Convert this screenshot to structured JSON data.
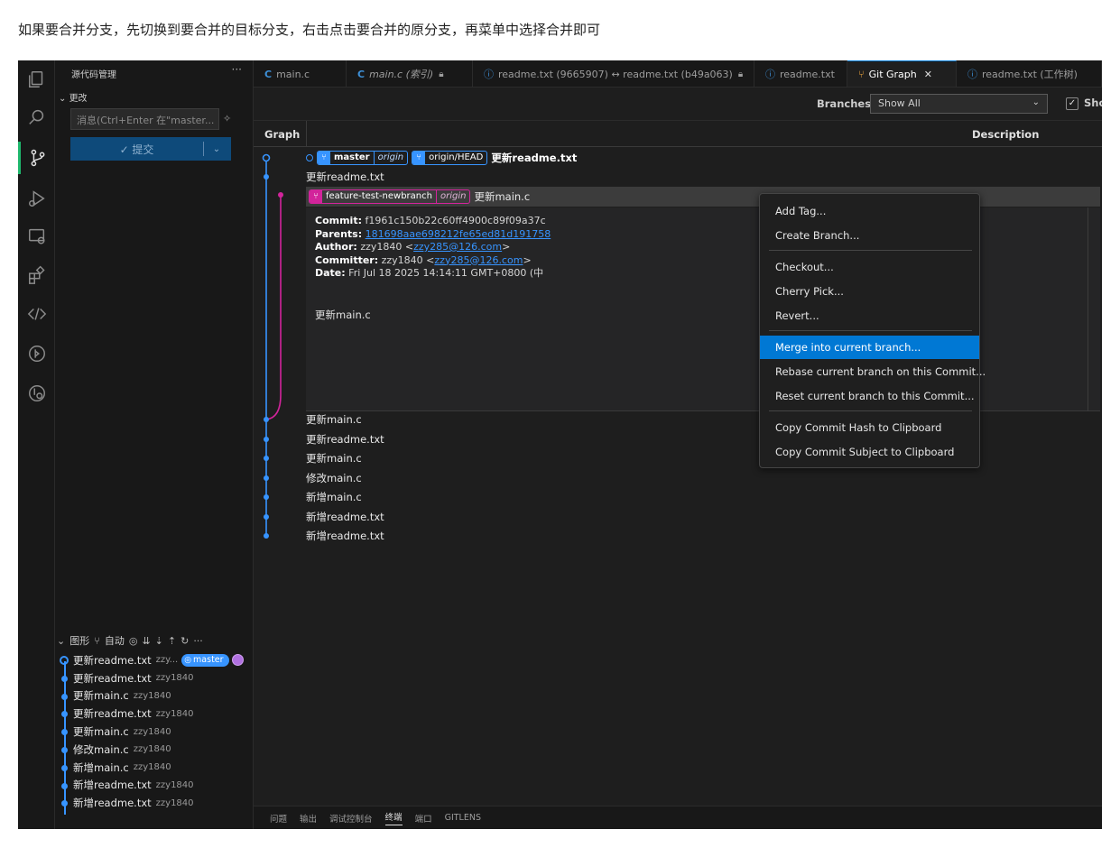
{
  "caption": "如果要合并分支，先切换到要合并的目标分支，右击点击要合并的原分支，再菜单中选择合并即可",
  "sidebar": {
    "title": "源代码管理",
    "more": "···",
    "section": "更改",
    "message_placeholder": "消息(Ctrl+Enter 在\"master...",
    "commit_label": "✓ 提交",
    "graph_header": "图形",
    "graph_auto": "自动",
    "commits": [
      {
        "subject": "更新readme.txt",
        "author": "zzy...",
        "badge": "master"
      },
      {
        "subject": "更新readme.txt",
        "author": "zzy1840"
      },
      {
        "subject": "更新main.c",
        "author": "zzy1840"
      },
      {
        "subject": "更新readme.txt",
        "author": "zzy1840"
      },
      {
        "subject": "更新main.c",
        "author": "zzy1840"
      },
      {
        "subject": "修改main.c",
        "author": "zzy1840"
      },
      {
        "subject": "新增main.c",
        "author": "zzy1840"
      },
      {
        "subject": "新增readme.txt",
        "author": "zzy1840"
      },
      {
        "subject": "新增readme.txt",
        "author": "zzy1840"
      }
    ]
  },
  "tabs": [
    {
      "label": "main.c"
    },
    {
      "label": "main.c (索引)"
    },
    {
      "label": "readme.txt (9665907) ↔ readme.txt (b49a063)"
    },
    {
      "label": "readme.txt"
    },
    {
      "label": "Git Graph"
    },
    {
      "label": "readme.txt (工作树)"
    }
  ],
  "toolbar": {
    "branches_label": "Branches:",
    "branches_value": "Show All",
    "show_label": "Show"
  },
  "graph": {
    "col_graph": "Graph",
    "col_description": "Description",
    "head_row": {
      "ref1": "master",
      "ref1_origin": "origin",
      "ref2": "origin/HEAD",
      "subject": "更新readme.txt"
    },
    "row2": "更新readme.txt",
    "sel_row": {
      "ref": "feature-test-newbranch",
      "ref_origin": "origin",
      "subject": "更新main.c"
    },
    "details": {
      "commit_label": "Commit:",
      "commit": "f1961c150b22c60ff4900c89f09a37c",
      "parents_label": "Parents:",
      "parents": "181698aae698212fe65ed81d191758",
      "author_label": "Author:",
      "author": "zzy1840 <",
      "author_email": "zzy285@126.com",
      "author_end": ">",
      "committer_label": "Committer:",
      "committer": "zzy1840 <",
      "committer_email": "zzy285@126.com",
      "committer_end": ">",
      "date_label": "Date:",
      "date": "Fri Jul 18 2025 14:14:11 GMT+0800 (中",
      "body": "更新main.c"
    },
    "rows": [
      "更新main.c",
      "更新readme.txt",
      "更新main.c",
      "修改main.c",
      "新增main.c",
      "新增readme.txt",
      "新增readme.txt"
    ]
  },
  "context_menu": {
    "items": [
      "Add Tag...",
      "Create Branch...",
      "Checkout...",
      "Cherry Pick...",
      "Revert...",
      "Merge into current branch...",
      "Rebase current branch on this Commit...",
      "Reset current branch to this Commit...",
      "Copy Commit Hash to Clipboard",
      "Copy Commit Subject to Clipboard"
    ]
  },
  "panel": {
    "tabs": [
      "问题",
      "输出",
      "调试控制台",
      "终端",
      "端口",
      "GITLENS"
    ]
  },
  "colors": {
    "accent": "#0078d4",
    "branch_blue": "#3794ff",
    "branch_pink": "#d2249b",
    "activity_indicator": "#1fb86d"
  }
}
